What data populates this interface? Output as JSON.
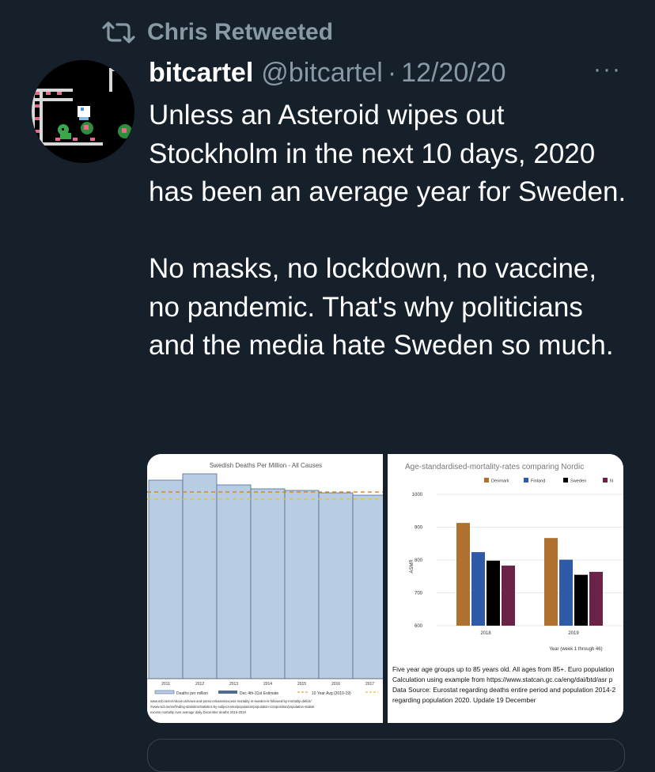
{
  "retweet": {
    "icon": "retweet-icon",
    "text": "Chris Retweeted"
  },
  "author": {
    "name": "bitcartel",
    "handle": "@bitcartel",
    "separator": "·",
    "date": "12/20/20"
  },
  "more_label": "···",
  "tweet": {
    "paragraphs": [
      "Unless an Asteroid wipes out Stockholm in the next 10 days, 2020 has been an average year for Sweden.",
      "No masks, no lockdown, no vaccine, no pandemic. That's why politicians and the media hate Sweden so much."
    ]
  },
  "colors": {
    "background": "#15202b",
    "secondary_text": "#8899a6",
    "bar_fill": "#b8cce4",
    "bar_edge": "#4f6d8f"
  },
  "media": {
    "left_chart": {
      "chart_data": {
        "type": "bar",
        "title": "Swedish Deaths Per Million - All Causes",
        "categories": [
          "2011",
          "2012",
          "2013",
          "2014",
          "2015",
          "2016",
          "2017"
        ],
        "legend": [
          "Deaths per million",
          "Dec 4th-31st Estimate",
          "10 Year Avg (2010-19)"
        ],
        "sources": [
          "www.scb.se/en/About-us/news-and-press-releases/excess-mortality-in-sweden-is-followed-by-mortality-deficit/",
          "//www.scb.se/en/finding-statistics/statistics-by-subject-area/population/population-composition/population-statisti",
          "excess mortality over average daily December deaths 2015-2019"
        ]
      }
    },
    "right_chart": {
      "chart_data": {
        "type": "bar",
        "title": "Age-standardised-mortality-rates comparing Nordic",
        "categories": [
          "2018",
          "2019"
        ],
        "series": [
          {
            "name": "Denmark",
            "color": "#b07030",
            "values": [
              913,
              867
            ]
          },
          {
            "name": "Finland",
            "color": "#2e5aa8",
            "values": [
              824,
              801
            ]
          },
          {
            "name": "Sweden",
            "color": "#000000",
            "values": [
              798,
              755
            ]
          },
          {
            "name": "N",
            "color": "#6a2346",
            "values": [
              783,
              764
            ]
          }
        ],
        "ylabel": "ASMR",
        "xlabel": "Year (week 1 through 46)",
        "yticks": [
          "1000",
          "900",
          "800",
          "700",
          "600"
        ],
        "ylim": [
          600,
          1000
        ],
        "notes": [
          "Five year age groups up to 85 years old. All ages from 85+. Euro population",
          "Calculation using example from https://www.statcan.gc.ca/eng/dai/btd/asr p",
          "Data Source: Eurostat regarding deaths entire period and population 2014-2",
          "regarding population 2020. Update 19 December"
        ]
      }
    }
  }
}
